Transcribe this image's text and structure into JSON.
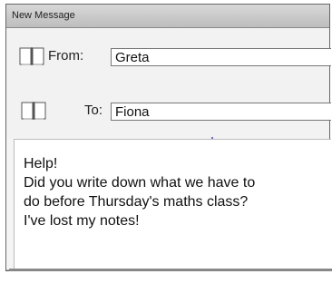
{
  "window": {
    "title": "New Message"
  },
  "header": {
    "from_label": "From:",
    "from_value": "Greta",
    "to_label": "To:",
    "to_value": "Fiona",
    "icon": "address-book-icon"
  },
  "message": {
    "lines": [
      "Help!",
      "Did you write down what we have to",
      "do before Thursday's maths class?",
      "I've lost my notes!"
    ]
  },
  "colors": {
    "titlebar": "#c8c8c8",
    "background": "#f2f2f2",
    "accent_dot": "#7b66c7"
  }
}
